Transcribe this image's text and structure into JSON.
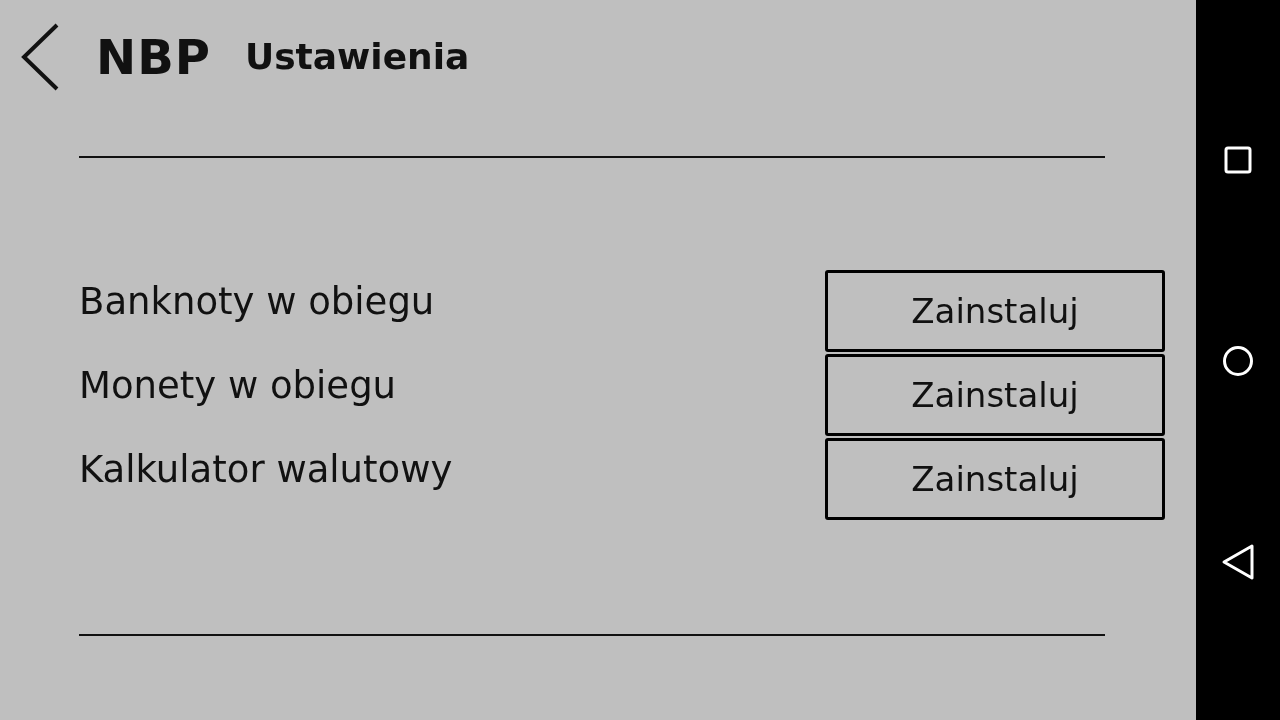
{
  "header": {
    "logo": "NBP",
    "title": "Ustawienia"
  },
  "items": [
    {
      "label": "Banknoty w obiegu",
      "button": "Zainstaluj"
    },
    {
      "label": "Monety w obiegu",
      "button": "Zainstaluj"
    },
    {
      "label": "Kalkulator walutowy",
      "button": "Zainstaluj"
    }
  ]
}
